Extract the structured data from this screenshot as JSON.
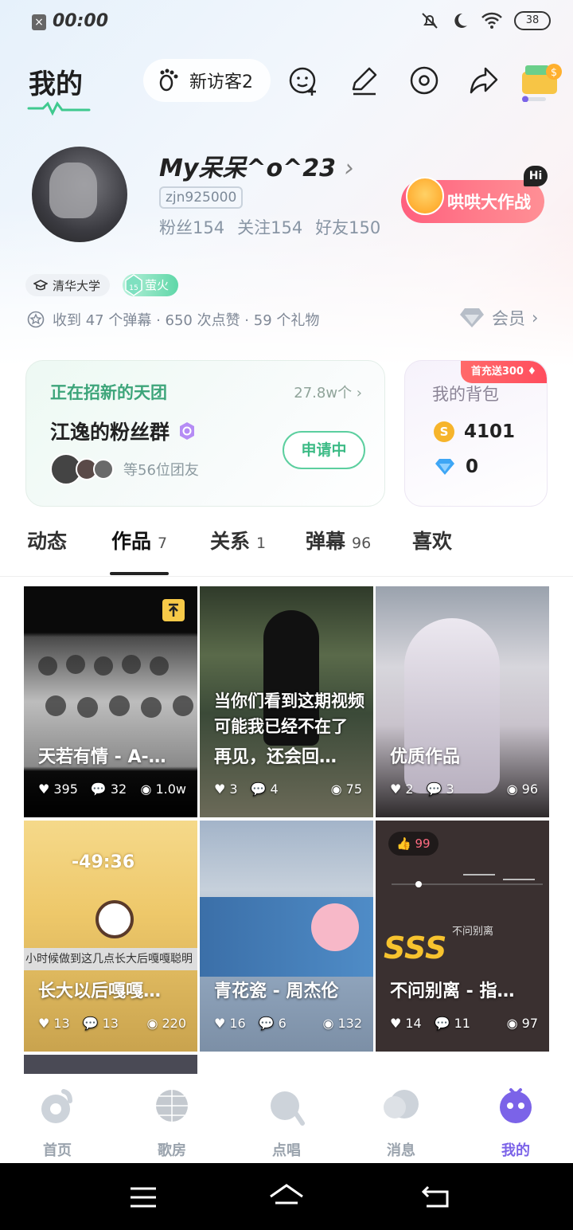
{
  "status_bar": {
    "time": "00:00",
    "battery": "38"
  },
  "header": {
    "title": "我的",
    "visitor_label": "新访客2"
  },
  "profile": {
    "username": "My呆呆^o^23",
    "chevron": "›",
    "user_id": "zjn925000",
    "fans": "粉丝154",
    "following": "关注154",
    "friends": "好友150",
    "event_button": "哄哄大作战",
    "event_badge": "Hi",
    "school_tag": "清华大学",
    "level_tag": "萤火",
    "level_num": "15",
    "received_summary": "收到 47 个弹幕 · 650 次点赞 · 59 个礼物",
    "vip_label": "会员"
  },
  "fan_group": {
    "heading": "正在招新的天团",
    "count": "27.8w个",
    "name": "江逸的粉丝群",
    "members_text": "等56位团友",
    "apply_button": "申请中"
  },
  "bag": {
    "title": "我的背包",
    "promo": "首充送300",
    "coins": "4101",
    "diamonds": "0"
  },
  "tabs": [
    {
      "label": "动态",
      "count": ""
    },
    {
      "label": "作品",
      "count": "7"
    },
    {
      "label": "关系",
      "count": "1"
    },
    {
      "label": "弹幕",
      "count": "96"
    },
    {
      "label": "喜欢",
      "count": ""
    }
  ],
  "works": [
    {
      "title": "天若有情 - A-…",
      "likes": "395",
      "comments": "32",
      "views": "1.0w"
    },
    {
      "title": "再见，还会回…",
      "likes": "3",
      "comments": "4",
      "views": "75",
      "overlay": "当你们看到这期视频可能我已经不在了"
    },
    {
      "title": "优质作品",
      "likes": "2",
      "comments": "3",
      "views": "96"
    },
    {
      "title": "长大以后嘎嘎…",
      "likes": "13",
      "comments": "13",
      "views": "220",
      "caption": "小时候做到这几点长大后嘎嘎聪明",
      "timer": "-49:36"
    },
    {
      "title": "青花瓷 - 周杰伦",
      "likes": "16",
      "comments": "6",
      "views": "132"
    },
    {
      "title": "不问别离 - 指…",
      "likes": "14",
      "comments": "11",
      "views": "97",
      "badge": "99",
      "grade": "SSS",
      "song_label": "不问别离"
    }
  ],
  "bottom_nav": [
    {
      "label": "首页"
    },
    {
      "label": "歌房"
    },
    {
      "label": "点唱"
    },
    {
      "label": "消息"
    },
    {
      "label": "我的"
    }
  ],
  "colors": {
    "accent": "#7b63e8",
    "green": "#3dbb86",
    "event": "#ff5f7e"
  }
}
